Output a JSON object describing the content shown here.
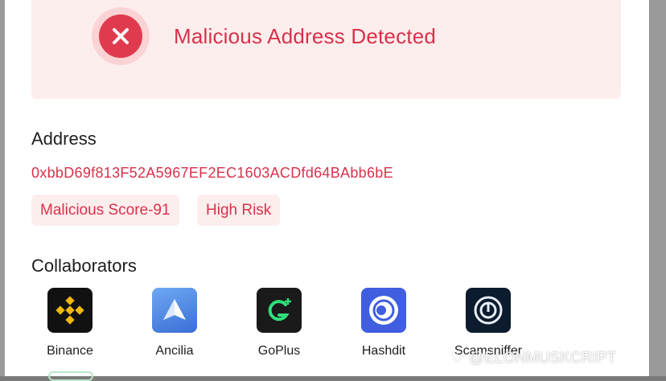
{
  "alert": {
    "title": "Malicious Address Detected",
    "icon": "close-x-icon",
    "color": "#d9314a"
  },
  "address": {
    "heading": "Address",
    "value": "0xbbD69f813F52A5967EF2EC1603ACDfd64BAbb6bE"
  },
  "tags": [
    {
      "label": "Malicious Score-91"
    },
    {
      "label": "High Risk"
    }
  ],
  "collaborators": {
    "heading": "Collaborators",
    "items": [
      {
        "name": "Binance",
        "icon": "binance-logo"
      },
      {
        "name": "Ancilia",
        "icon": "ancilia-logo"
      },
      {
        "name": "GoPlus",
        "icon": "goplus-logo"
      },
      {
        "name": "Hashdit",
        "icon": "hashdit-logo"
      },
      {
        "name": "Scamsniffer",
        "icon": "scamsniffer-logo"
      }
    ]
  },
  "watermark": "@ELONMUSKCRIPT"
}
